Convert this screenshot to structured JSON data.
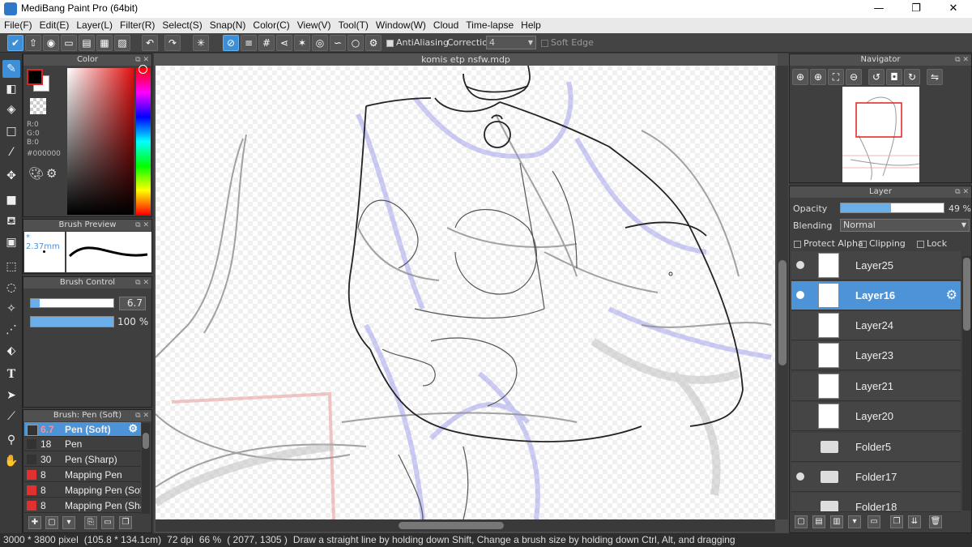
{
  "window": {
    "title": "MediBang Paint Pro (64bit)",
    "minimize": "—",
    "maximize": "❐",
    "close": "✕"
  },
  "menu": [
    "File(F)",
    "Edit(E)",
    "Layer(L)",
    "Filter(R)",
    "Select(S)",
    "Snap(N)",
    "Color(C)",
    "View(V)",
    "Tool(T)",
    "Window(W)",
    "Cloud",
    "Time-lapse",
    "Help"
  ],
  "toolbar": {
    "antialiasing_label": "AntiAliasing",
    "correction_label": "Correction",
    "correction_value": "4",
    "soft_edge_label": "Soft Edge"
  },
  "document": {
    "tab_title": "komis etp nsfw.mdp"
  },
  "color_panel": {
    "title": "Color",
    "r": "R:0",
    "g": "G:0",
    "b": "B:0",
    "hex": "#000000",
    "foreground": "#000000"
  },
  "brush_preview": {
    "title": "Brush Preview",
    "size": "* 2.37mm"
  },
  "brush_control": {
    "title": "Brush Control",
    "size_value": "6.7",
    "opacity_value": "100 %"
  },
  "brush_list": {
    "title": "Brush: Pen (Soft)",
    "items": [
      {
        "size": "6.7",
        "name": "Pen (Soft)",
        "color": "#333333"
      },
      {
        "size": "18",
        "name": "Pen",
        "color": "#333333"
      },
      {
        "size": "30",
        "name": "Pen (Sharp)",
        "color": "#333333"
      },
      {
        "size": "8",
        "name": "Mapping Pen",
        "color": "#e03030"
      },
      {
        "size": "8",
        "name": "Mapping Pen (Soft)",
        "color": "#e03030"
      },
      {
        "size": "8",
        "name": "Mapping Pen (Sharp)",
        "color": "#e03030"
      }
    ]
  },
  "navigator": {
    "title": "Navigator"
  },
  "layer_panel": {
    "title": "Layer",
    "opacity_label": "Opacity",
    "opacity_value": "49 %",
    "opacity_fraction": 0.49,
    "blending_label": "Blending",
    "blending_value": "Normal",
    "protect_alpha": "Protect Alpha",
    "clipping": "Clipping",
    "lock": "Lock",
    "layers": [
      {
        "name": "Layer25",
        "type": "layer",
        "visible": true,
        "selected": false
      },
      {
        "name": "Layer16",
        "type": "layer",
        "visible": true,
        "selected": true
      },
      {
        "name": "Layer24",
        "type": "layer",
        "visible": false,
        "selected": false
      },
      {
        "name": "Layer23",
        "type": "layer",
        "visible": false,
        "selected": false
      },
      {
        "name": "Layer21",
        "type": "layer",
        "visible": false,
        "selected": false
      },
      {
        "name": "Layer20",
        "type": "layer",
        "visible": false,
        "selected": false
      },
      {
        "name": "Folder5",
        "type": "folder",
        "visible": false,
        "selected": false
      },
      {
        "name": "Folder17",
        "type": "folder",
        "visible": true,
        "selected": false
      },
      {
        "name": "Folder18",
        "type": "folder",
        "visible": false,
        "selected": false
      }
    ]
  },
  "status": {
    "size": "3000 * 3800 pixel",
    "physical": "(105.8 * 134.1cm)",
    "dpi": "72 dpi",
    "zoom": "66 %",
    "coords": "( 2077, 1305 )",
    "hint": "Draw a straight line by holding down Shift, Change a brush size by holding down Ctrl, Alt, and dragging"
  },
  "colors": {
    "accent": "#4d93d7",
    "panel": "#3f3f3f",
    "sketch_blue": "#9b9be8",
    "sketch_red": "#e89090"
  }
}
